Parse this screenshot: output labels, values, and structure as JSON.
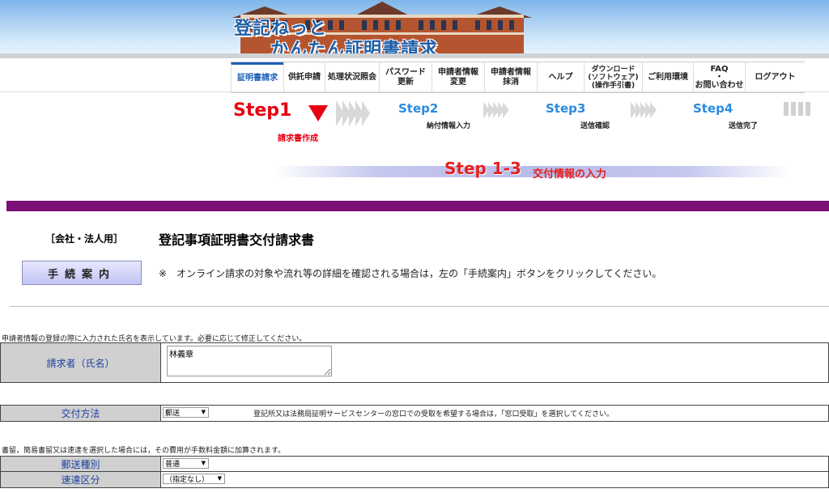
{
  "header": {
    "logo_line1": "登記ねっと",
    "logo_line2": "かんたん証明書請求"
  },
  "nav": [
    {
      "label": "証明書請求",
      "active": true
    },
    {
      "label": "供託申請"
    },
    {
      "label": "処理状況照会"
    },
    {
      "label": "パスワード\n更新"
    },
    {
      "label": "申請者情報\n変更"
    },
    {
      "label": "申請者情報\n抹消"
    },
    {
      "label": "ヘルプ"
    },
    {
      "label": "ダウンロード\n(ソフトウェア)\n(操作手引書)"
    },
    {
      "label": "ご利用環境"
    },
    {
      "label": "FAQ\n・\nお問い合わせ"
    },
    {
      "label": "ログアウト"
    }
  ],
  "steps": {
    "step1": "Step1",
    "step1_sub": "請求書作成",
    "step2": "Step2",
    "step2_sub": "納付情報入力",
    "step3": "Step3",
    "step3_sub": "送信確認",
    "step4": "Step4",
    "step4_sub": "送信完了",
    "substep": "Step 1-3",
    "substep_title": "交付情報の入力"
  },
  "form": {
    "corp_label": "［会社・法人用］",
    "title": "登記事項証明書交付請求書",
    "guide_button": "手続案内",
    "guide_note": "※　オンライン請求の対象や流れ等の詳細を確認される場合は，左の「手続案内」ボタンをクリックしてください。",
    "name_note": "申請者情報の登録の際に入力された氏名を表示しています。必要に応じて修正してください。",
    "requester_label": "請求者（氏名）",
    "requester_value": "林義章",
    "delivery_label": "交付方法",
    "delivery_value": "郵送",
    "delivery_hint": "登記所又は法務局証明サービスセンターの窓口での受取を希望する場合は，「窓口受取」を選択してください。",
    "mail_note": "書留，簡易書留又は速達を選択した場合には，その費用が手数料金額に加算されます。",
    "mail_type_label": "郵送種別",
    "mail_type_value": "普通",
    "express_label": "速達区分",
    "express_value": "（指定なし）"
  },
  "colors": {
    "accent_red": "#e60012",
    "step_blue": "#2b8be0",
    "band_purple": "#7b1075"
  }
}
